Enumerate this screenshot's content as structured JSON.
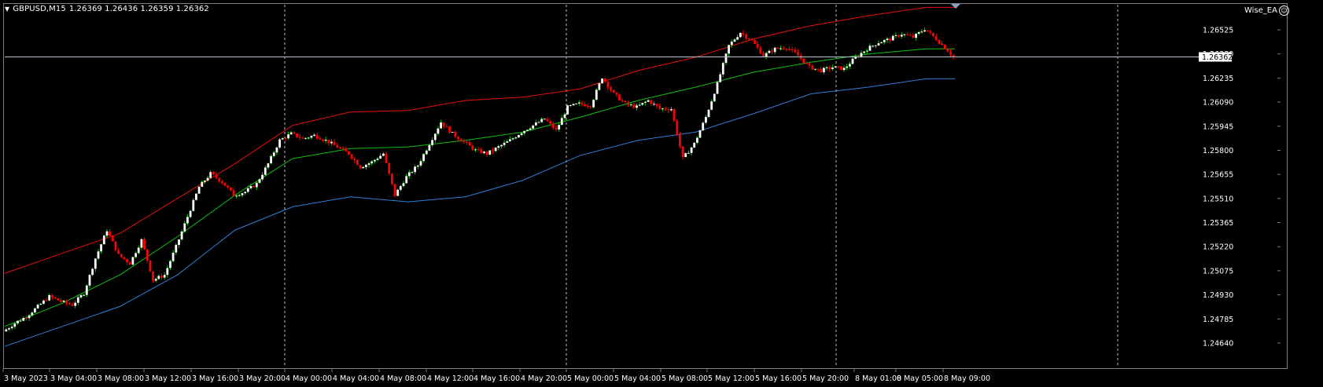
{
  "header": {
    "symbol": "GBPUSD,M15",
    "ohlc": "1.26369 1.26436 1.26359 1.26362"
  },
  "expert": {
    "name": "Wise_EA",
    "icon": "smiley-icon"
  },
  "colors": {
    "background": "#000000",
    "bull_candle": "#ffffff",
    "bear_candle": "#ff0000",
    "bull_wick": "#00cc00",
    "upper_band": "#e81010",
    "middle_band": "#10c010",
    "lower_band": "#2e7fd9",
    "grid": "#c0c0c0",
    "axis": "#7f7f7f",
    "text": "#ffffff"
  },
  "chart_data": {
    "type": "candlestick",
    "price_axis_labels": [
      "1.26525",
      "1.26380",
      "1.26235",
      "1.26090",
      "1.25945",
      "1.25800",
      "1.25655",
      "1.25510",
      "1.25365",
      "1.25220",
      "1.25075",
      "1.24930",
      "1.24785",
      "1.24640"
    ],
    "current_price": "1.26362",
    "time_axis_labels": [
      "3 May 2023",
      "3 May 04:00",
      "3 May 08:00",
      "3 May 12:00",
      "3 May 16:00",
      "3 May 20:00",
      "4 May 00:00",
      "4 May 04:00",
      "4 May 08:00",
      "4 May 12:00",
      "4 May 16:00",
      "4 May 20:00",
      "5 May 00:00",
      "5 May 04:00",
      "5 May 08:00",
      "5 May 12:00",
      "5 May 16:00",
      "5 May 20:00",
      "8 May 01:00",
      "8 May 05:00",
      "8 May 09:00"
    ],
    "day_separators": [
      "4 May 00:00",
      "5 May 00:00",
      "8 May 01:00",
      "8 May 13:00"
    ],
    "close_path": [
      [
        0,
        1.2471
      ],
      [
        4,
        1.2476
      ],
      [
        8,
        1.248
      ],
      [
        12,
        1.2486
      ],
      [
        16,
        1.2492
      ],
      [
        20,
        1.2489
      ],
      [
        24,
        1.2487
      ],
      [
        28,
        1.2494
      ],
      [
        32,
        1.2515
      ],
      [
        36,
        1.2532
      ],
      [
        40,
        1.2517
      ],
      [
        44,
        1.2512
      ],
      [
        48,
        1.2526
      ],
      [
        52,
        1.2502
      ],
      [
        56,
        1.2505
      ],
      [
        60,
        1.2522
      ],
      [
        64,
        1.254
      ],
      [
        68,
        1.2558
      ],
      [
        72,
        1.2566
      ],
      [
        76,
        1.2561
      ],
      [
        80,
        1.2553
      ],
      [
        84,
        1.2555
      ],
      [
        88,
        1.256
      ],
      [
        92,
        1.2572
      ],
      [
        96,
        1.2586
      ],
      [
        100,
        1.259
      ],
      [
        104,
        1.2587
      ],
      [
        108,
        1.2589
      ],
      [
        112,
        1.2586
      ],
      [
        116,
        1.2582
      ],
      [
        120,
        1.2578
      ],
      [
        124,
        1.257
      ],
      [
        128,
        1.2573
      ],
      [
        132,
        1.2578
      ],
      [
        136,
        1.2553
      ],
      [
        140,
        1.2564
      ],
      [
        144,
        1.2571
      ],
      [
        148,
        1.2584
      ],
      [
        152,
        1.2597
      ],
      [
        156,
        1.259
      ],
      [
        160,
        1.2585
      ],
      [
        164,
        1.258
      ],
      [
        168,
        1.2578
      ],
      [
        172,
        1.2582
      ],
      [
        176,
        1.2586
      ],
      [
        180,
        1.2591
      ],
      [
        184,
        1.2595
      ],
      [
        188,
        1.2599
      ],
      [
        192,
        1.2592
      ],
      [
        196,
        1.2606
      ],
      [
        200,
        1.2608
      ],
      [
        204,
        1.2607
      ],
      [
        208,
        1.2624
      ],
      [
        212,
        1.2614
      ],
      [
        216,
        1.2608
      ],
      [
        220,
        1.2606
      ],
      [
        224,
        1.261
      ],
      [
        228,
        1.2605
      ],
      [
        232,
        1.2605
      ],
      [
        236,
        1.2575
      ],
      [
        240,
        1.2584
      ],
      [
        244,
        1.26
      ],
      [
        248,
        1.262
      ],
      [
        252,
        1.2643
      ],
      [
        256,
        1.2651
      ],
      [
        260,
        1.2646
      ],
      [
        264,
        1.2637
      ],
      [
        268,
        1.2641
      ],
      [
        272,
        1.2642
      ],
      [
        276,
        1.2637
      ],
      [
        280,
        1.263
      ],
      [
        284,
        1.2628
      ],
      [
        288,
        1.263
      ],
      [
        292,
        1.2629
      ],
      [
        296,
        1.2636
      ],
      [
        300,
        1.2641
      ],
      [
        304,
        1.2645
      ],
      [
        308,
        1.2647
      ],
      [
        312,
        1.265
      ],
      [
        316,
        1.2648
      ],
      [
        320,
        1.2653
      ],
      [
        324,
        1.2647
      ],
      [
        328,
        1.264
      ],
      [
        330,
        1.26362
      ]
    ],
    "upper_band": [
      [
        0,
        1.2506
      ],
      [
        20,
        1.2518
      ],
      [
        40,
        1.253
      ],
      [
        60,
        1.2551
      ],
      [
        80,
        1.2572
      ],
      [
        100,
        1.2595
      ],
      [
        120,
        1.2603
      ],
      [
        140,
        1.2604
      ],
      [
        160,
        1.261
      ],
      [
        180,
        1.2612
      ],
      [
        200,
        1.2617
      ],
      [
        220,
        1.2628
      ],
      [
        240,
        1.2636
      ],
      [
        260,
        1.2647
      ],
      [
        280,
        1.2655
      ],
      [
        300,
        1.2661
      ],
      [
        320,
        1.2666
      ],
      [
        330,
        1.2666
      ]
    ],
    "middle_band": [
      [
        0,
        1.2474
      ],
      [
        20,
        1.2488
      ],
      [
        40,
        1.2505
      ],
      [
        60,
        1.2528
      ],
      [
        80,
        1.2553
      ],
      [
        100,
        1.2575
      ],
      [
        120,
        1.2581
      ],
      [
        140,
        1.2582
      ],
      [
        160,
        1.2586
      ],
      [
        180,
        1.2591
      ],
      [
        200,
        1.26
      ],
      [
        220,
        1.261
      ],
      [
        240,
        1.2618
      ],
      [
        260,
        1.2627
      ],
      [
        280,
        1.2633
      ],
      [
        300,
        1.2638
      ],
      [
        320,
        1.2641
      ],
      [
        330,
        1.2641
      ]
    ],
    "lower_band": [
      [
        0,
        1.2462
      ],
      [
        20,
        1.2474
      ],
      [
        40,
        1.2486
      ],
      [
        60,
        1.2505
      ],
      [
        80,
        1.2532
      ],
      [
        100,
        1.2546
      ],
      [
        120,
        1.2552
      ],
      [
        140,
        1.2549
      ],
      [
        160,
        1.2552
      ],
      [
        180,
        1.2562
      ],
      [
        200,
        1.2577
      ],
      [
        220,
        1.2586
      ],
      [
        240,
        1.2591
      ],
      [
        260,
        1.2602
      ],
      [
        280,
        1.2614
      ],
      [
        300,
        1.2618
      ],
      [
        320,
        1.2623
      ],
      [
        330,
        1.2623
      ]
    ]
  }
}
